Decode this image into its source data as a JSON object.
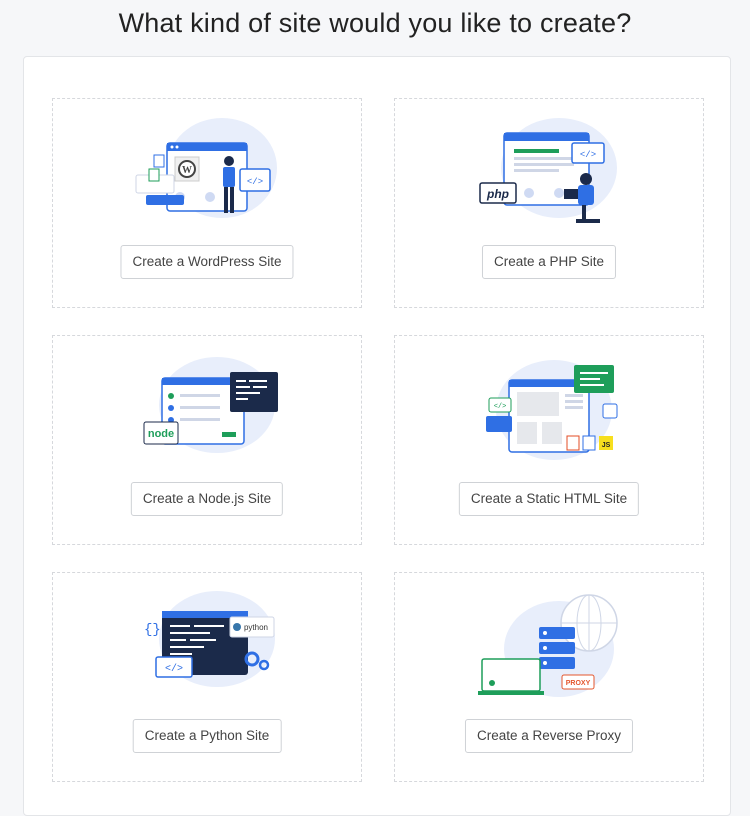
{
  "title": "What kind of site would you like to create?",
  "cards": [
    {
      "button": "Create a WordPress Site",
      "illustration": "wordpress-illustration"
    },
    {
      "button": "Create a PHP Site",
      "illustration": "php-illustration",
      "badge": "php"
    },
    {
      "button": "Create a Node.js Site",
      "illustration": "nodejs-illustration",
      "badge": "node"
    },
    {
      "button": "Create a Static HTML Site",
      "illustration": "static-html-illustration",
      "badge": "JS"
    },
    {
      "button": "Create a Python Site",
      "illustration": "python-illustration",
      "badge": "python"
    },
    {
      "button": "Create a Reverse Proxy",
      "illustration": "reverse-proxy-illustration",
      "badge": "PROXY"
    }
  ],
  "colors": {
    "accent": "#2f6fe4",
    "dark": "#1b2a4a",
    "green": "#1e9e5a"
  }
}
